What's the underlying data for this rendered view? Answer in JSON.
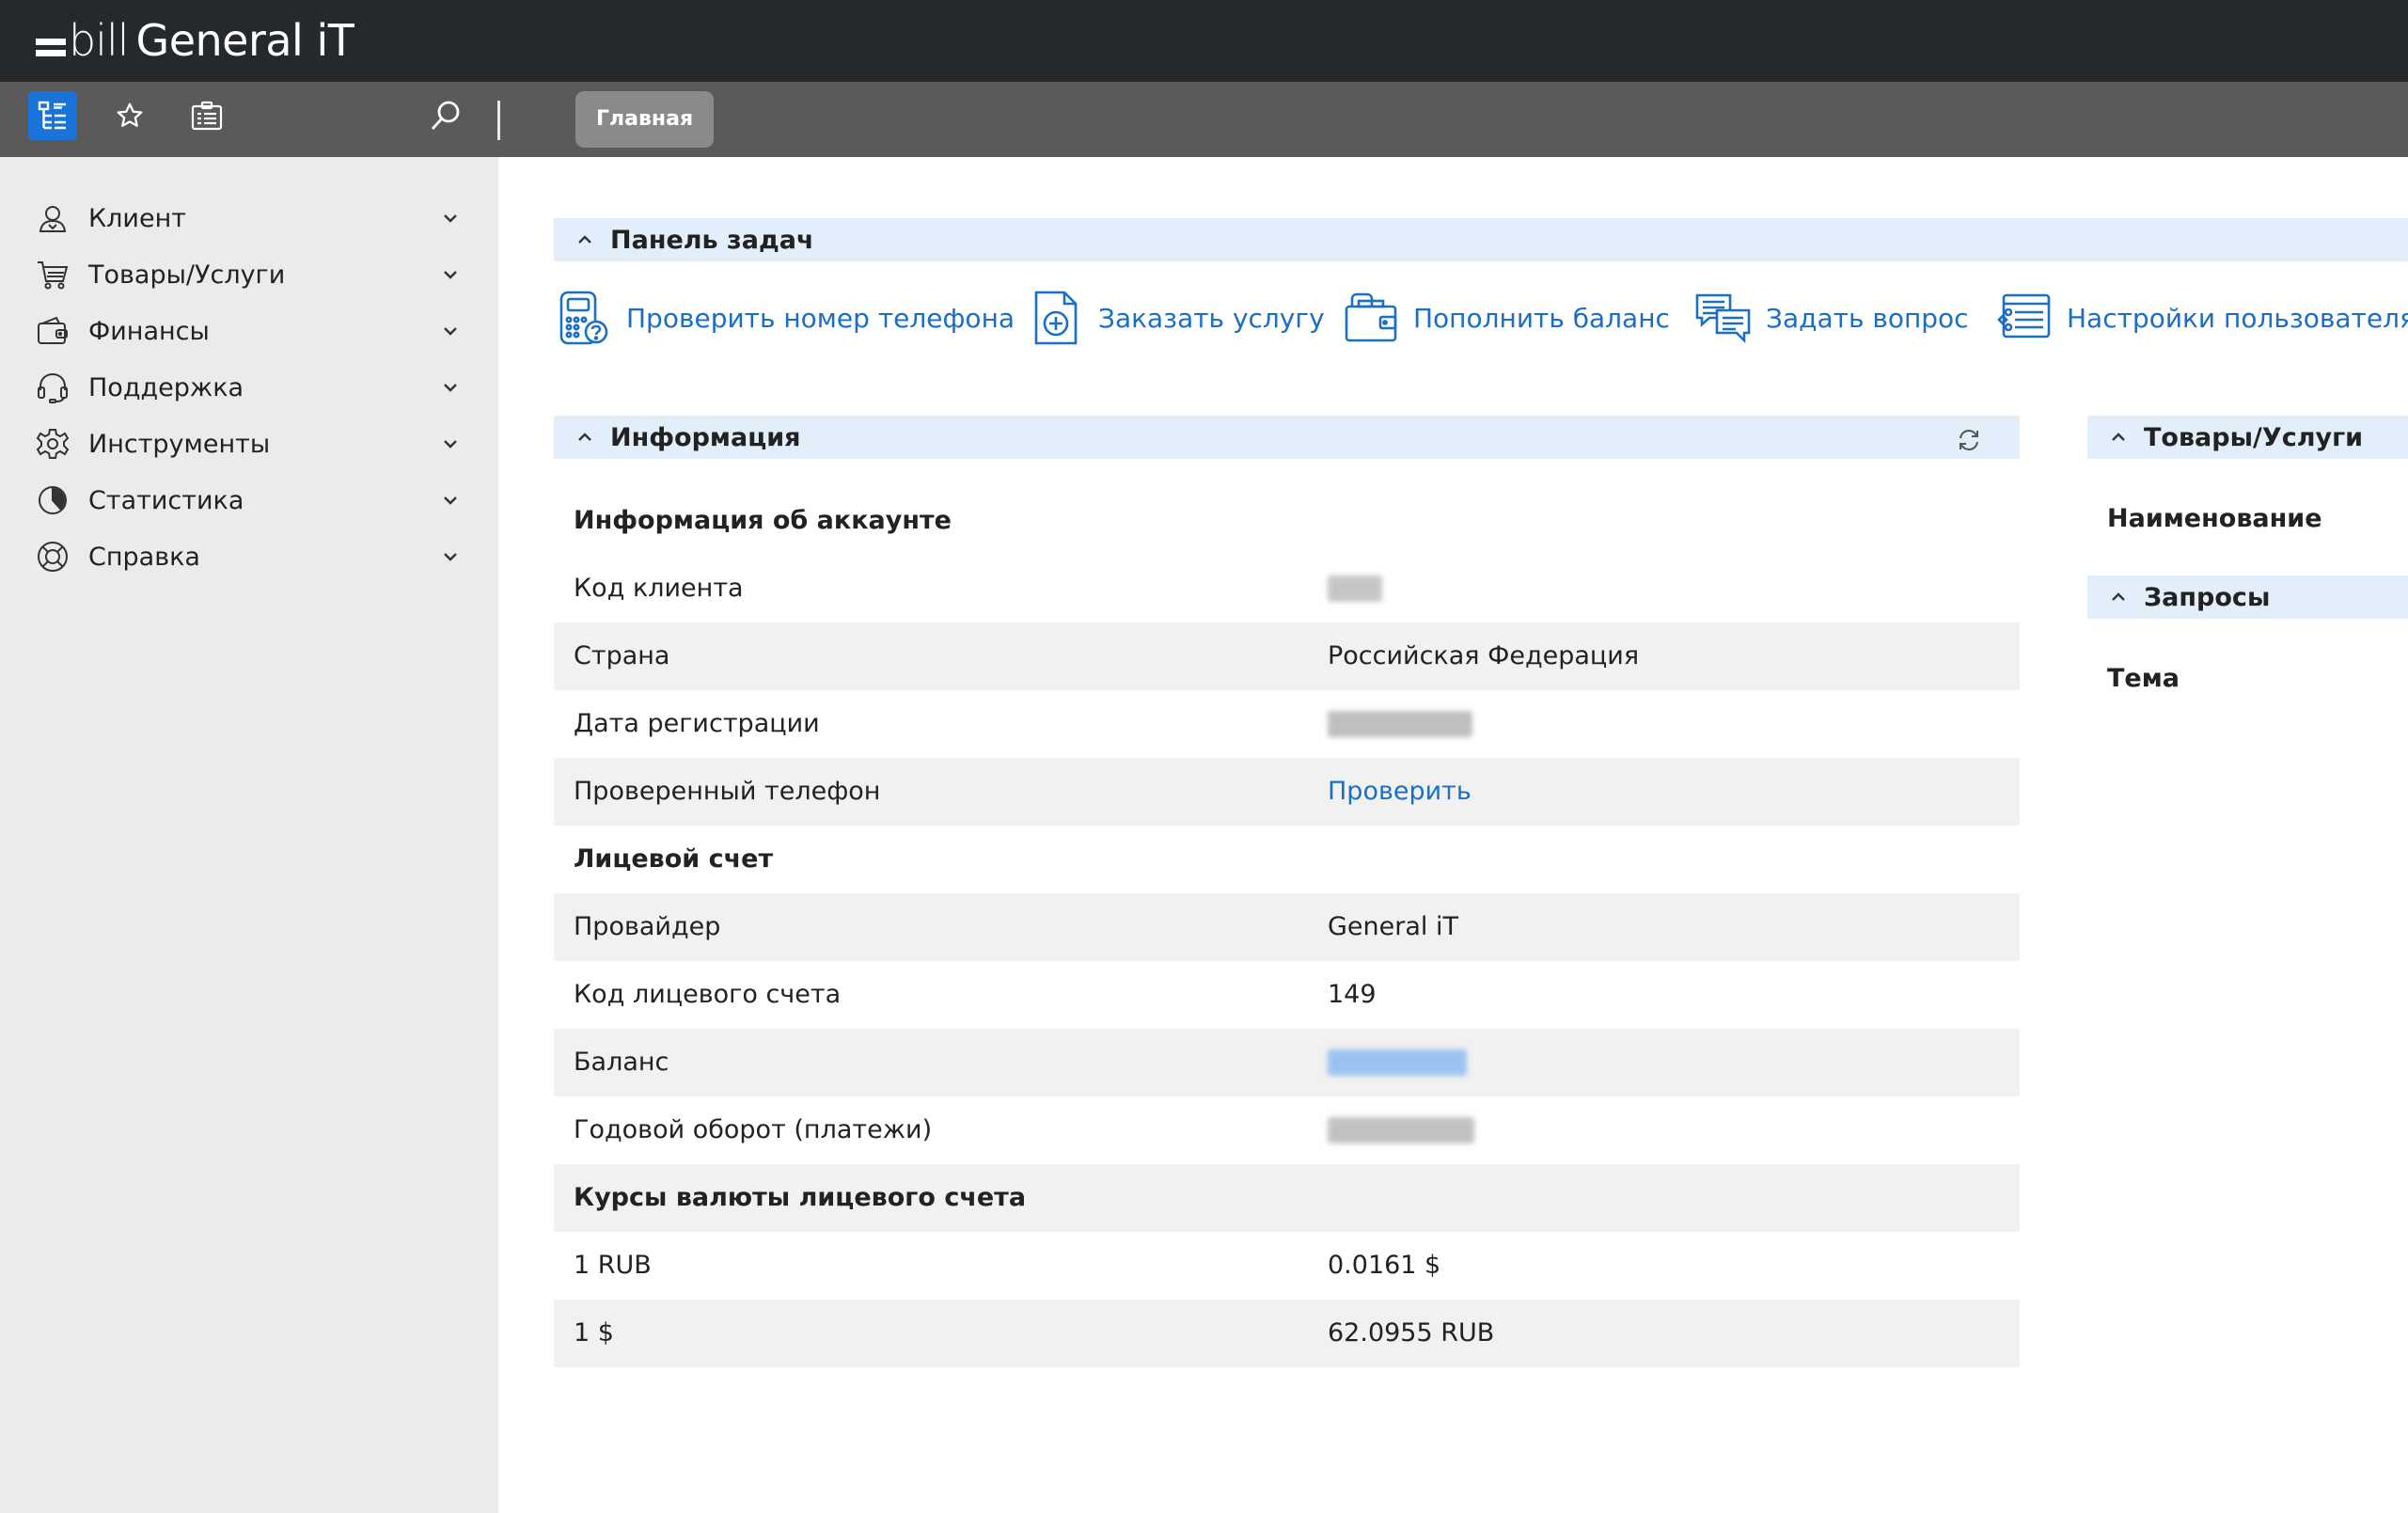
{
  "app": {
    "logo_text": "bill",
    "company": "General iT"
  },
  "toolbar": {
    "home_tab": "Главная"
  },
  "sidebar": {
    "items": [
      {
        "label": "Клиент",
        "icon": "user-icon"
      },
      {
        "label": "Товары/Услуги",
        "icon": "cart-icon"
      },
      {
        "label": "Финансы",
        "icon": "wallet-icon"
      },
      {
        "label": "Поддержка",
        "icon": "headset-icon"
      },
      {
        "label": "Инструменты",
        "icon": "gear-icon"
      },
      {
        "label": "Статистика",
        "icon": "pie-chart-icon"
      },
      {
        "label": "Справка",
        "icon": "lifebuoy-icon"
      }
    ]
  },
  "taskbar": {
    "title": "Панель задач",
    "tasks": [
      {
        "label": "Проверить номер телефона",
        "icon": "phone-check-icon"
      },
      {
        "label": "Заказать услугу",
        "icon": "order-service-icon"
      },
      {
        "label": "Пополнить баланс",
        "icon": "wallet-topup-icon"
      },
      {
        "label": "Задать вопрос",
        "icon": "chat-question-icon"
      },
      {
        "label": "Настройки пользователя",
        "icon": "user-settings-icon"
      }
    ]
  },
  "info": {
    "title": "Информация",
    "account_header": "Информация об аккаунте",
    "client_code_label": "Код клиента",
    "country_label": "Страна",
    "country_value": "Российская Федерация",
    "reg_date_label": "Дата регистрации",
    "phone_label": "Проверенный телефон",
    "phone_value": "Проверить",
    "personal_account_header": "Лицевой счет",
    "provider_label": "Провайдер",
    "provider_value": "General iT",
    "account_code_label": "Код лицевого счета",
    "account_code_value": "149",
    "balance_label": "Баланс",
    "turnover_label": "Годовой оборот (платежи)",
    "rates_header": "Курсы валюты лицевого счета",
    "rates": [
      {
        "label": "1 RUB",
        "value": "0.0161 $"
      },
      {
        "label": "1 $",
        "value": "62.0955 RUB"
      }
    ]
  },
  "products": {
    "title": "Товары/Услуги",
    "column": "Наименование"
  },
  "requests": {
    "title": "Запросы",
    "column": "Тема"
  },
  "colors": {
    "accent": "#1a6fc4",
    "section_header": "#e3eefb",
    "header_bg": "#26292c",
    "toolbar_bg": "#5a5a5a",
    "sidebar_bg": "#ebebeb"
  }
}
